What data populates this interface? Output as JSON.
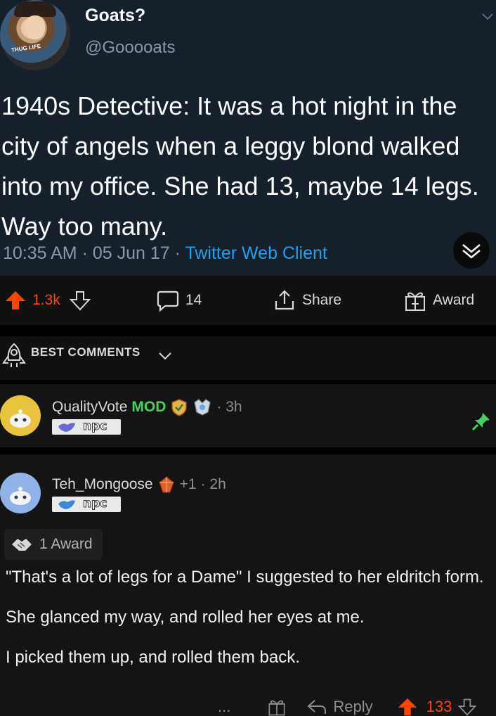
{
  "tweet": {
    "display_name": "Goats?",
    "handle": "@Gooooats",
    "avatar_caption": "THUG LIFE",
    "text": "1940s Detective: It was a hot night in the city of angels when a leggy blond walked into my office. She had 13, maybe 14 legs. Way too many.",
    "time": "10:35 AM",
    "date": "05 Jun 17",
    "client": "Twitter Web Client",
    "sep": " · "
  },
  "post_actions": {
    "score": "1.3k",
    "comments": "14",
    "share_label": "Share",
    "award_label": "Award"
  },
  "sort": {
    "label": "BEST COMMENTS"
  },
  "comments": [
    {
      "username": "QualityVote",
      "mod_badge": "MOD",
      "age": "· 3h",
      "flair": "npc",
      "pinned": true
    },
    {
      "username": "Teh_Mongoose",
      "karma_badge": "+1",
      "age": "· 2h",
      "flair": "npc",
      "award_count": "1 Award",
      "paragraphs": [
        "\"That's a lot of legs for a Dame\" I suggested to her eldritch form.",
        "She glanced my way, and rolled her eyes at me.",
        "I picked them up, and rolled them back."
      ],
      "more": "...",
      "reply_label": "Reply",
      "score": "133"
    }
  ],
  "colors": {
    "twitter_bg": "#15202b",
    "twitter_blue": "#1da1f2",
    "upvote": "#ff4500",
    "mod_green": "#46d160",
    "pin_green": "#46d160"
  },
  "icons": {
    "upvote": "arrow-up-icon",
    "downvote": "arrow-down-icon",
    "comment": "speech-bubble-icon",
    "share": "share-icon",
    "award": "gift-icon",
    "sort": "rocket-icon",
    "pin": "pin-icon"
  }
}
